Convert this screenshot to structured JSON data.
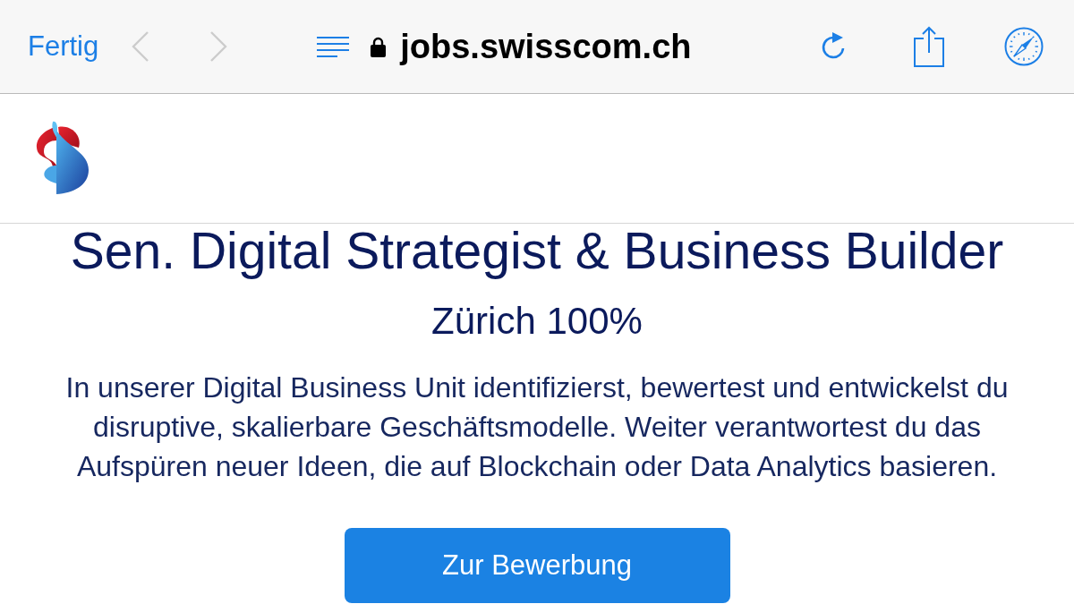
{
  "browser_toolbar": {
    "done_button": "Fertig",
    "back_button": {
      "disabled": true
    },
    "forward_button": {
      "disabled": true
    },
    "url": "jobs.swisscom.ch",
    "secure": true
  },
  "job": {
    "title": "Sen. Digital Strategist & Business Builder",
    "location": "Zürich 100%",
    "description": "In unserer Digital Business Unit identifizierst, bewertest und entwickelst du disruptive, skalierbare Geschäftsmodelle. Weiter verantwortest du das Aufspüren neuer Ideen, die auf Blockchain oder Data Analytics basieren.",
    "apply_button": "Zur Bewerbung"
  }
}
